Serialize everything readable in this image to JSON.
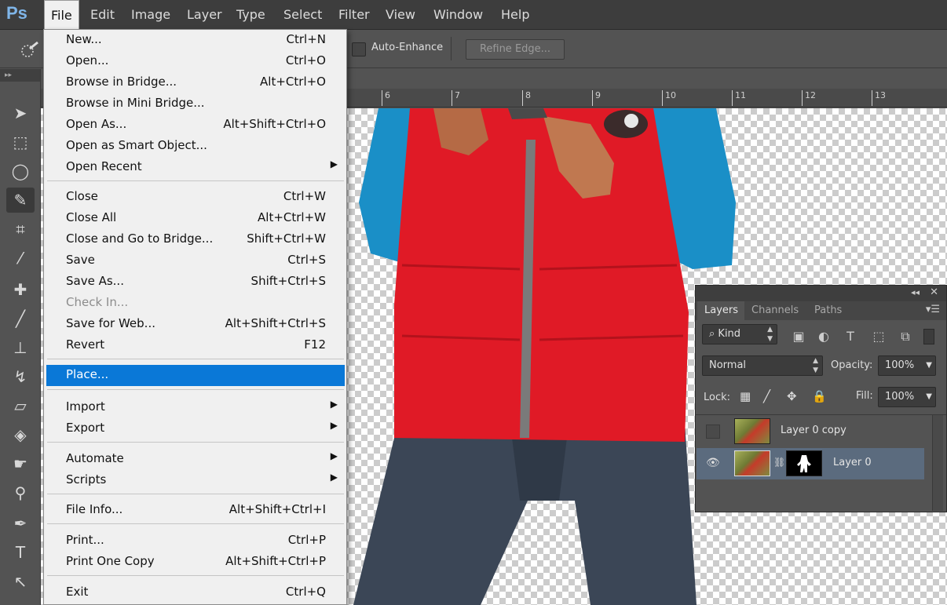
{
  "app": {
    "logo": "Ps"
  },
  "menubar": {
    "items": [
      {
        "label": "File"
      },
      {
        "label": "Edit"
      },
      {
        "label": "Image"
      },
      {
        "label": "Layer"
      },
      {
        "label": "Type"
      },
      {
        "label": "Select"
      },
      {
        "label": "Filter"
      },
      {
        "label": "View"
      },
      {
        "label": "Window"
      },
      {
        "label": "Help"
      }
    ]
  },
  "options_bar": {
    "auto_enhance_label": "Auto-Enhance",
    "auto_enhance_checked": false,
    "refine_edge_label": "Refine Edge..."
  },
  "ruler": {
    "ticks": [
      "6",
      "7",
      "8",
      "9",
      "10",
      "11",
      "12",
      "13"
    ]
  },
  "file_menu": {
    "items": [
      {
        "label": "New...",
        "shortcut": "Ctrl+N"
      },
      {
        "label": "Open...",
        "shortcut": "Ctrl+O"
      },
      {
        "label": "Browse in Bridge...",
        "shortcut": "Alt+Ctrl+O"
      },
      {
        "label": "Browse in Mini Bridge...",
        "shortcut": ""
      },
      {
        "label": "Open As...",
        "shortcut": "Alt+Shift+Ctrl+O"
      },
      {
        "label": "Open as Smart Object...",
        "shortcut": ""
      },
      {
        "label": "Open Recent",
        "shortcut": "",
        "submenu": true
      },
      {
        "label": "Close",
        "shortcut": "Ctrl+W"
      },
      {
        "label": "Close All",
        "shortcut": "Alt+Ctrl+W"
      },
      {
        "label": "Close and Go to Bridge...",
        "shortcut": "Shift+Ctrl+W"
      },
      {
        "label": "Save",
        "shortcut": "Ctrl+S"
      },
      {
        "label": "Save As...",
        "shortcut": "Shift+Ctrl+S"
      },
      {
        "label": "Check In...",
        "shortcut": "",
        "disabled": true
      },
      {
        "label": "Save for Web...",
        "shortcut": "Alt+Shift+Ctrl+S"
      },
      {
        "label": "Revert",
        "shortcut": "F12"
      },
      {
        "label": "Place...",
        "shortcut": "",
        "highlighted": true
      },
      {
        "label": "Import",
        "shortcut": "",
        "submenu": true
      },
      {
        "label": "Export",
        "shortcut": "",
        "submenu": true
      },
      {
        "label": "Automate",
        "shortcut": "",
        "submenu": true
      },
      {
        "label": "Scripts",
        "shortcut": "",
        "submenu": true
      },
      {
        "label": "File Info...",
        "shortcut": "Alt+Shift+Ctrl+I"
      },
      {
        "label": "Print...",
        "shortcut": "Ctrl+P"
      },
      {
        "label": "Print One Copy",
        "shortcut": "Alt+Shift+Ctrl+P"
      },
      {
        "label": "Exit",
        "shortcut": "Ctrl+Q"
      }
    ]
  },
  "layers_panel": {
    "tabs": [
      "Layers",
      "Channels",
      "Paths"
    ],
    "active_tab": "Layers",
    "filter": "Kind",
    "blend_mode": "Normal",
    "opacity_label": "Opacity:",
    "opacity_value": "100%",
    "lock_label": "Lock:",
    "fill_label": "Fill:",
    "fill_value": "100%",
    "layers": [
      {
        "name": "Layer 0 copy",
        "visible": false,
        "has_mask": false
      },
      {
        "name": "Layer 0",
        "visible": true,
        "has_mask": true,
        "selected": true
      }
    ]
  },
  "colors": {
    "menu_highlight": "#0a78d7",
    "jacket": "#e01a26",
    "sleeve": "#1a8fc7",
    "jeans": "#3b4656",
    "layer_selected": "#5b6b7e"
  }
}
